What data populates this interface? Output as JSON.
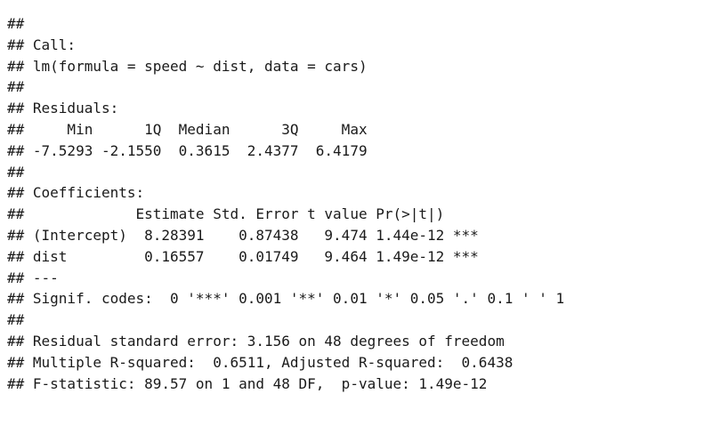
{
  "lines": [
    "##",
    "## Call:",
    "## lm(formula = speed ~ dist, data = cars)",
    "##",
    "## Residuals:",
    "##     Min      1Q  Median      3Q     Max",
    "## -7.5293 -2.1550  0.3615  2.4377  6.4179",
    "##",
    "## Coefficients:",
    "##             Estimate Std. Error t value Pr(>|t|)",
    "## (Intercept)  8.28391    0.87438   9.474 1.44e-12 ***",
    "## dist         0.16557    0.01749   9.464 1.49e-12 ***",
    "## ---",
    "## Signif. codes:  0 '***' 0.001 '**' 0.01 '*' 0.05 '.' 0.1 ' ' 1",
    "##",
    "## Residual standard error: 3.156 on 48 degrees of freedom",
    "## Multiple R-squared:  0.6511, Adjusted R-squared:  0.6438",
    "## F-statistic: 89.57 on 1 and 48 DF,  p-value: 1.49e-12"
  ]
}
